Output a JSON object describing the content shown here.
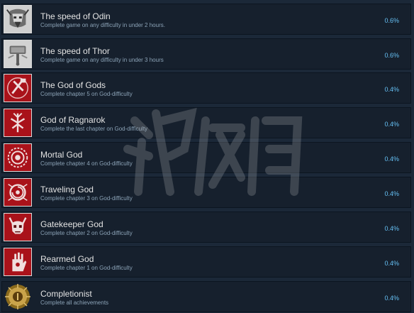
{
  "achievements": [
    {
      "title": "The speed of Odin",
      "description": "Complete game on any difficulty in under 2 hours.",
      "percent": "0.6%",
      "icon": "odin-helm-icon"
    },
    {
      "title": "The speed of Thor",
      "description": "Complete game on any difficulty in under 3 hours",
      "percent": "0.6%",
      "icon": "thor-hammer-icon"
    },
    {
      "title": "The God of Gods",
      "description": "Complete chapter 5 on God-difficulty",
      "percent": "0.4%",
      "icon": "god-of-gods-icon"
    },
    {
      "title": "God of Ragnarok",
      "description": "Complete the last chapter on God-difficulty",
      "percent": "0.4%",
      "icon": "ragnarok-icon"
    },
    {
      "title": "Mortal God",
      "description": "Complete chapter 4 on God-difficulty",
      "percent": "0.4%",
      "icon": "mortal-god-icon"
    },
    {
      "title": "Traveling God",
      "description": "Complete chapter 3 on God-difficulty",
      "percent": "0.4%",
      "icon": "traveling-god-icon"
    },
    {
      "title": "Gatekeeper God",
      "description": "Complete chapter 2 on God-difficulty",
      "percent": "0.4%",
      "icon": "gatekeeper-skull-icon"
    },
    {
      "title": "Rearmed God",
      "description": "Complete chapter 1 on God-difficulty",
      "percent": "0.4%",
      "icon": "rearmed-hand-icon"
    },
    {
      "title": "Completionist",
      "description": "Complete all achievements",
      "percent": "0.4%",
      "icon": "completionist-sun-icon"
    }
  ],
  "colors": {
    "background": "#1b2838",
    "row": "#16202d",
    "title": "#e3e3e3",
    "description": "#8ca3b7",
    "percent": "#66c0f4",
    "icon_red": "#b3151c"
  }
}
